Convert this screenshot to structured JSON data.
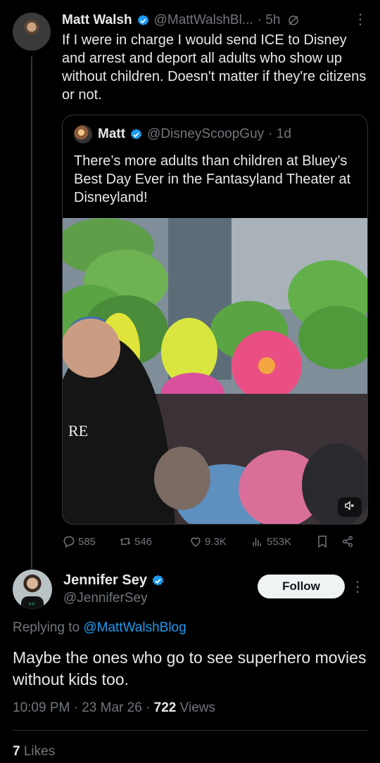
{
  "post": {
    "author_name": "Matt Walsh",
    "author_handle": "@MattWalshBl...",
    "time": "· 5h",
    "text": "If I were in charge I would send ICE to Disney and arrest and deport all adults who show up without children. Doesn't matter if they're citizens or not.",
    "quote": {
      "author_name": "Matt",
      "author_handle": "@DisneyScoopGuy",
      "time": "· 1d",
      "text": "There’s more adults than children at Bluey’s Best Day Ever in the Fantasyland Theater at Disneyland!"
    },
    "stats": {
      "replies": "585",
      "reposts": "546",
      "likes": "9.3K",
      "views": "553K"
    }
  },
  "reply": {
    "author_name": "Jennifer Sey",
    "author_handle": "@JenniferSey",
    "follow_label": "Follow",
    "replying_prefix": "Replying to",
    "replying_to": "@MattWalshBlog",
    "text": "Maybe the ones who go to see superhero movies without kids too.",
    "time": "10:09 PM",
    "date": "23 Mar 26",
    "views_count": "722",
    "views_label": "Views",
    "likes_count": "7",
    "likes_label": "Likes"
  },
  "icons": [
    "verified-icon",
    "grok-icon",
    "more-icon",
    "reply-icon",
    "repost-icon",
    "like-icon",
    "views-icon",
    "bookmark-icon",
    "share-icon",
    "mute-icon"
  ],
  "colors": {
    "background": "#000000",
    "text": "#e7e9ea",
    "muted": "#71767b",
    "accent": "#1d9bf0",
    "border": "#2f3336"
  }
}
